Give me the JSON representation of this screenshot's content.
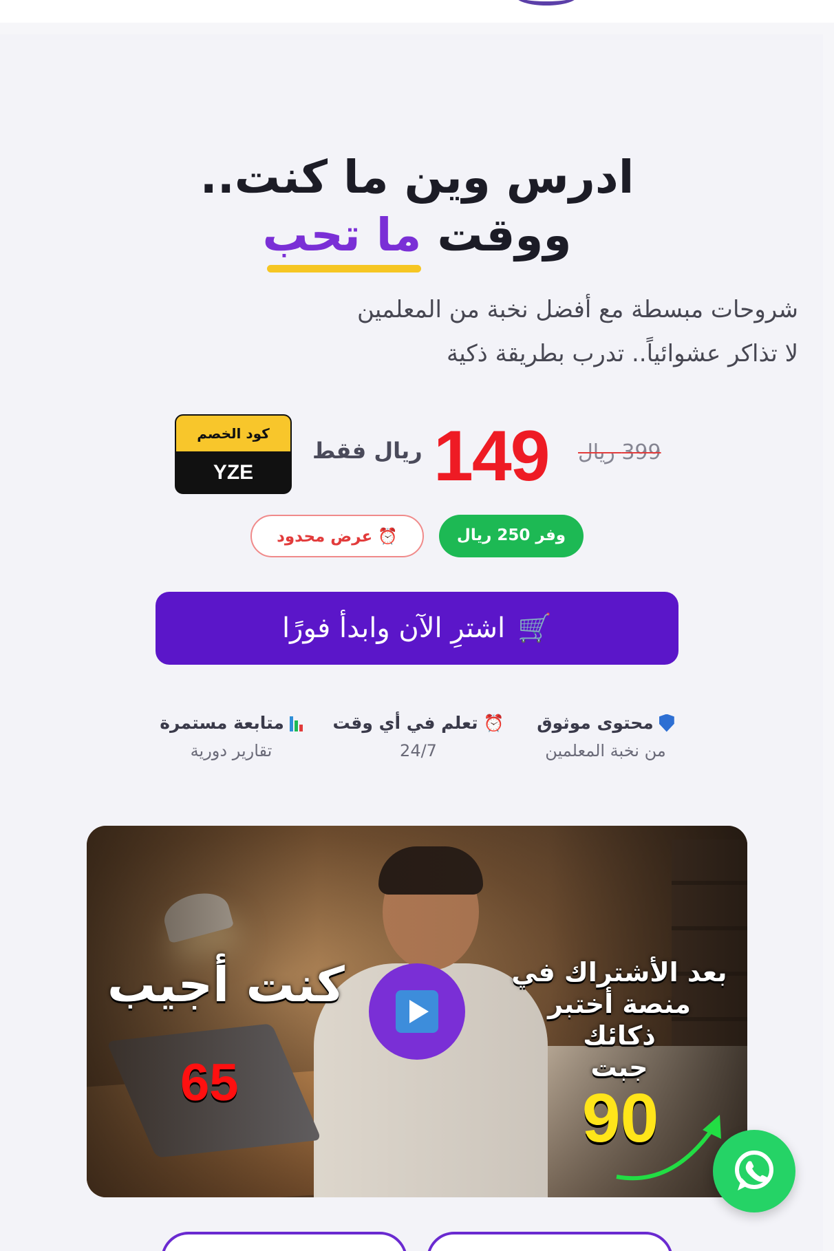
{
  "hero": {
    "title_line1": "ادرس وين ما كنت..",
    "title_line2_plain": "ووقت",
    "title_line2_highlight": "ما تحب",
    "subtitle_line1": "شروحات مبسطة مع أفضل نخبة من المعلمين",
    "subtitle_line2": "لا تذاكر عشوائياً.. تدرب بطريقة ذكية"
  },
  "pricing": {
    "old_price": "399 ريال",
    "new_price": "149",
    "new_price_suffix": "ريال فقط",
    "coupon_label": "كود الخصم",
    "coupon_code": "YZE",
    "save_badge": "وفر 250 ريال",
    "limited_badge": "عرض محدود",
    "colors": {
      "price": "#ee1b24",
      "save": "#1db954",
      "coupon_top": "#f8c62b"
    }
  },
  "cta": {
    "label": "اشترِ الآن وابدأ فورًا",
    "icon": "cart-icon",
    "color": "#5b16c9"
  },
  "features": [
    {
      "icon": "shield-icon",
      "title": "محتوى موثوق",
      "subtitle": "من نخبة المعلمين"
    },
    {
      "icon": "clock-icon",
      "title": "تعلم في أي وقت",
      "subtitle": "24/7"
    },
    {
      "icon": "bar-chart-icon",
      "title": "متابعة مستمرة",
      "subtitle": "تقارير دورية"
    }
  ],
  "video": {
    "left_caption": "كنت أجيب",
    "left_score": "65",
    "right_caption_line1": "بعد الأشتراك في",
    "right_caption_line2": "منصة أختبر ذكائك",
    "right_caption_line3": "جبت",
    "right_score": "90"
  },
  "whatsapp": {
    "icon": "whatsapp-icon",
    "color": "#25d366"
  }
}
